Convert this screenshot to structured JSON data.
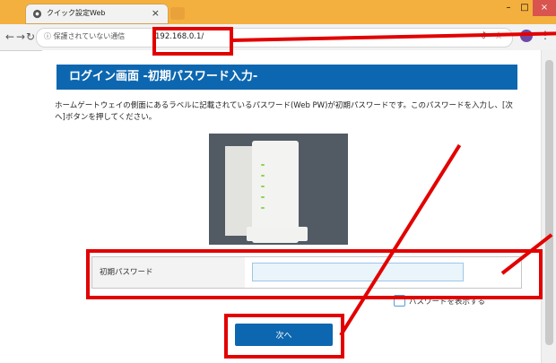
{
  "browser": {
    "tab_title": "クイック設定Web",
    "tab_close": "×",
    "security_label": "ⓘ 保護されていない通信",
    "url": "192.168.0.1/",
    "window_minimize": "–",
    "window_maximize": "□",
    "window_close": "×",
    "icons": [
      "back-icon",
      "forward-icon",
      "reload-icon",
      "key-icon",
      "star-icon",
      "menu-icon"
    ]
  },
  "page": {
    "header": "ログイン画面 -初期パスワード入力-",
    "description": "ホームゲートウェイの側面にあるラベルに記載されているパスワード(Web PW)が初期パスワードです。このパスワードを入力し、[次へ]ボタンを押してください。",
    "password_label": "初期パスワード",
    "password_value": "",
    "show_password_label": "パスワードを表示する",
    "next_button": "次へ"
  },
  "colors": {
    "chrome_bar": "#f4b03f",
    "header_blue": "#0d67b0",
    "highlight_red": "#e20000"
  }
}
